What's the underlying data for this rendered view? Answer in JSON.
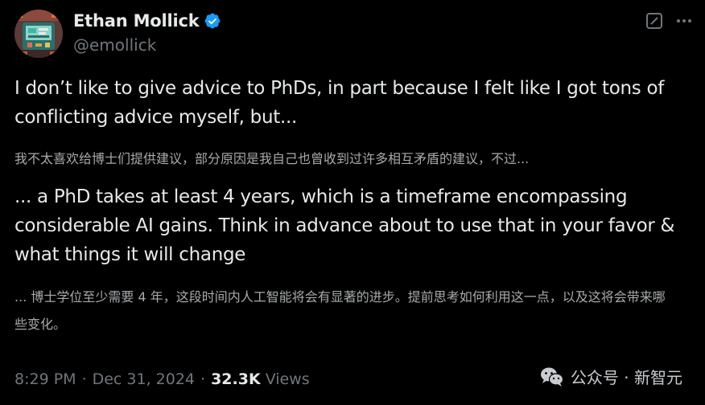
{
  "author": {
    "display_name": "Ethan Mollick",
    "handle": "@emollick",
    "verified": true,
    "avatar_icon": "pixel-art-avatar-icon",
    "verified_color": "#1d9bf0"
  },
  "toolbar": {
    "grok_icon": "grok-icon",
    "more_icon": "more-icon"
  },
  "tweet": {
    "paragraph1": "I don’t like to give advice to PhDs, in part because I felt like I got tons of conflicting advice myself, but...",
    "translation1": "我不太喜欢给博士们提供建议，部分原因是我自己也曾收到过许多相互矛盾的建议，不过...",
    "paragraph2": "... a PhD takes at least 4 years, which is a timeframe encompassing considerable AI gains. Think in advance about to use that in your favor & what things it will change",
    "translation2": "... 博士学位至少需要 4 年，这段时间内人工智能将会有显著的进步。提前思考如何利用这一点，以及这将会带来哪些变化。"
  },
  "meta": {
    "time": "8:29 PM",
    "separator": "·",
    "date": "Dec 31, 2024",
    "views_count": "32.3K",
    "views_label": "Views"
  },
  "watermark": {
    "icon": "wechat-icon",
    "text": "公众号 · 新智元"
  },
  "colors": {
    "background": "#000000",
    "primary_text": "#e7e9ea",
    "secondary_text": "#71767b",
    "translation_text": "#a7a9ab",
    "accent": "#1d9bf0"
  }
}
